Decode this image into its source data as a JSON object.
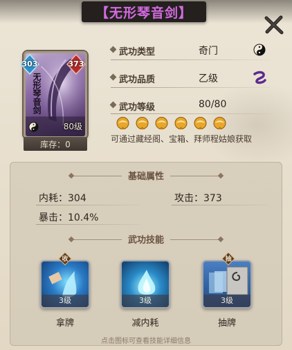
{
  "title": "【无形琴音剑】",
  "card": {
    "left_gem_value": "303",
    "right_gem_value": "373",
    "vertical_name": "无形琴音剑",
    "level": "80级",
    "stock": "库存：0"
  },
  "attributes": [
    {
      "label": "武功类型",
      "value": "奇门",
      "icon": "yin-yang-icon"
    },
    {
      "label": "武功品质",
      "value": "乙级",
      "icon": "quality-yi-icon"
    },
    {
      "label": "武功等级",
      "value": "80/80"
    }
  ],
  "stars": {
    "count": 6,
    "filled": 6
  },
  "source_text": "可通过藏经阁、宝箱、拜师程姑娘获取",
  "basic_section": {
    "title": "基础属性",
    "stats": [
      {
        "label": "内耗：",
        "value": "304"
      },
      {
        "label": "攻击：",
        "value": "373"
      },
      {
        "label": "暴击：",
        "value": "10.4%"
      }
    ]
  },
  "skill_section": {
    "title": "武功技能",
    "skills": [
      {
        "name": "拿牌",
        "level": "3级",
        "badge": "收"
      },
      {
        "name": "减内耗",
        "level": "3级",
        "badge": ""
      },
      {
        "name": "抽牌",
        "level": "3级",
        "badge": "抽"
      }
    ]
  },
  "hint": "点击图标可查看技能详细信息",
  "colors": {
    "title": "#d46be0",
    "label": "#4a3c30",
    "text": "#2e261f"
  }
}
